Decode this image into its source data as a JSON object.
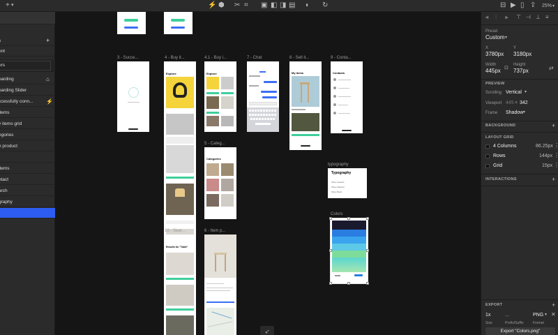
{
  "toolbar": {
    "zoom": "25%",
    "icons": [
      "plus-icon",
      "chevron-down-icon",
      "lightning-icon",
      "component-icon",
      "scissors-icon",
      "crop-icon",
      "union-icon",
      "subtract-icon",
      "intersect-icon",
      "exclude-icon",
      "mask-icon",
      "repeat-icon",
      "align-icon",
      "play-icon",
      "mobile-icon",
      "share-icon"
    ]
  },
  "layers": {
    "items": [
      {
        "label": "s",
        "icon": "plus-icon"
      },
      {
        "label": "ent"
      },
      {
        "label": "ers"
      },
      {
        "label": "oarding",
        "icon": "home-icon"
      },
      {
        "label": "oarding Slider"
      },
      {
        "label": "ccessfully conn...",
        "icon": "lightning-icon"
      },
      {
        "label": "items"
      },
      {
        "label": "y items grid"
      },
      {
        "label": "egories"
      },
      {
        "label": "n product"
      },
      {
        "label": "t"
      },
      {
        "label": "items"
      },
      {
        "label": "ntact"
      },
      {
        "label": "arch"
      },
      {
        "label": "graphy"
      },
      {
        "label": ""
      }
    ]
  },
  "canvas": {
    "labels": {
      "success": "3 - Succe...",
      "buy": "4 - Buy it...",
      "buy1": "4.1 - Buy i...",
      "chat": "7 - Chat",
      "sell": "8 - Sell it...",
      "contacts": "9 - Conta...",
      "categories": "5 - Categ...",
      "typography": "typography",
      "colors": "Colors",
      "search": "10 - Sear...",
      "item": "6 - Item p..."
    },
    "screen_titles": {
      "explore": "Explore",
      "categories": "Categories",
      "my_items": "My items",
      "contacts": "Contacts",
      "results": "Results for \"Table\"",
      "typography": "Typography"
    },
    "typography_lines": [
      "Shiny Heavier",
      "Shiny Medium",
      "Shiny Book"
    ],
    "color_swatches": [
      "#1a1a2e",
      "#2a7de1",
      "#3aa5ee",
      "#5ec9e6",
      "#7ddc9a",
      "#a6e6b0"
    ]
  },
  "inspector": {
    "preset_label": "Preset",
    "preset_value": "Custom",
    "x_label": "X",
    "x_value": "3780px",
    "y_label": "Y",
    "y_value": "3180px",
    "width_label": "Width",
    "width_value": "445px",
    "height_label": "Height",
    "height_value": "737px",
    "preview_heading": "PREVIEW",
    "scrolling_label": "Scrolling",
    "scrolling_value": "Vertical",
    "viewport_label": "Viewport",
    "viewport_w": "445",
    "viewport_x": "×",
    "viewport_h": "342",
    "frame_label": "Frame",
    "frame_value": "Shadow",
    "background_heading": "BACKGROUND",
    "layout_grid_heading": "LAYOUT GRID",
    "grid_rows": [
      {
        "name": "4 Columns",
        "value": "86.25px"
      },
      {
        "name": "Rows",
        "value": "144px"
      },
      {
        "name": "Grid",
        "value": "15px"
      }
    ],
    "interactions_heading": "INTERACTIONS",
    "export_heading": "EXPORT",
    "export_scale": "1x",
    "export_suffix": "...",
    "export_format": "PNG",
    "export_size_label": "Size",
    "export_prefix_label": "Prefix/Suffix",
    "export_format_label": "Format",
    "export_button": "Export \"Colors.png\""
  }
}
